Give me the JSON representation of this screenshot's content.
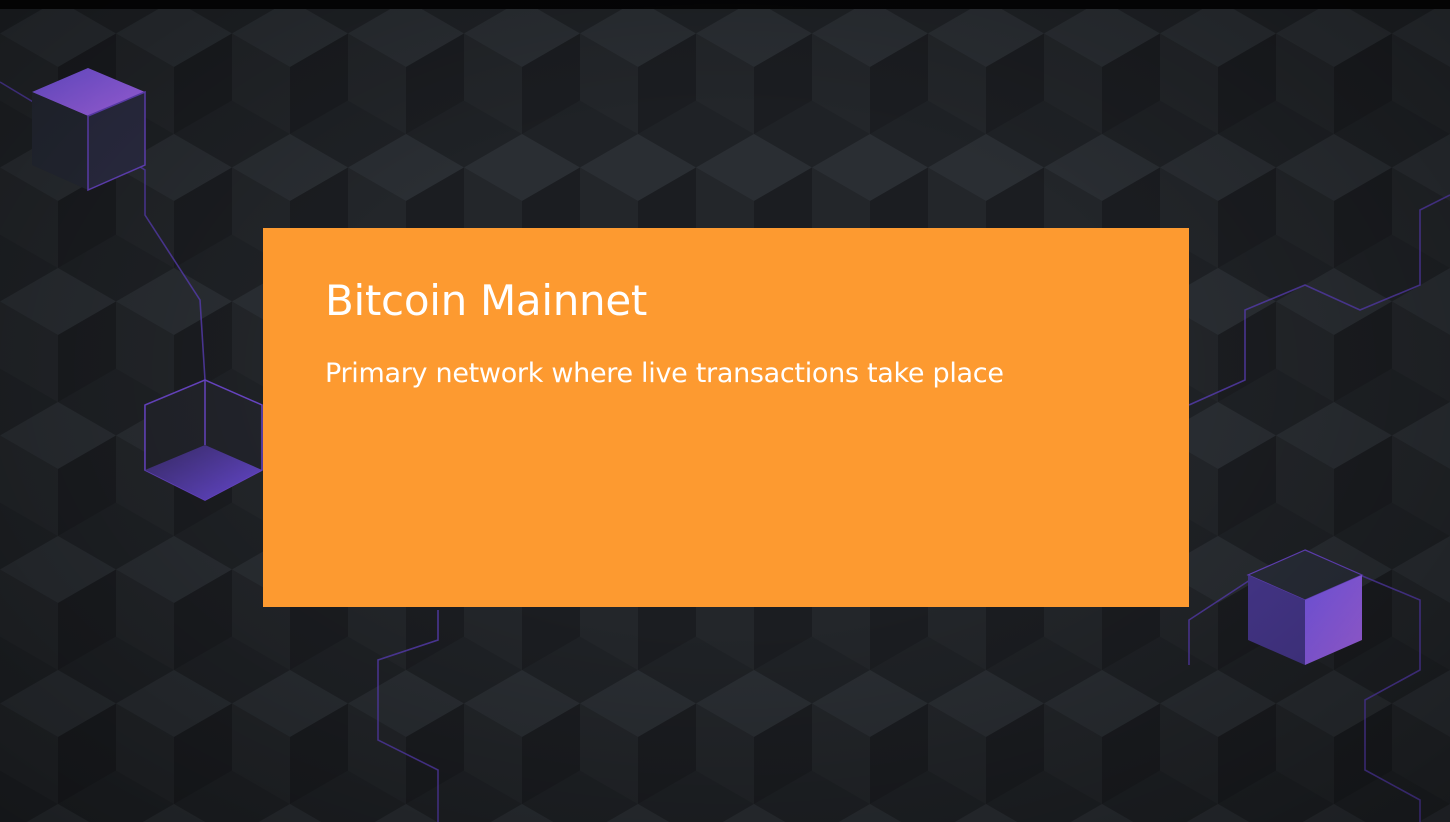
{
  "slide": {
    "title": "Bitcoin Mainnet",
    "subtitle": "Primary network where live transactions take place"
  },
  "colors": {
    "background": "#1e2125",
    "card": "#fd9a30",
    "text": "#ffffff",
    "accent_purple": "#8a4cf0",
    "line_purple": "#6a46c8"
  },
  "decorations": [
    "cube-icon",
    "cube-icon",
    "cube-icon",
    "network-line"
  ]
}
